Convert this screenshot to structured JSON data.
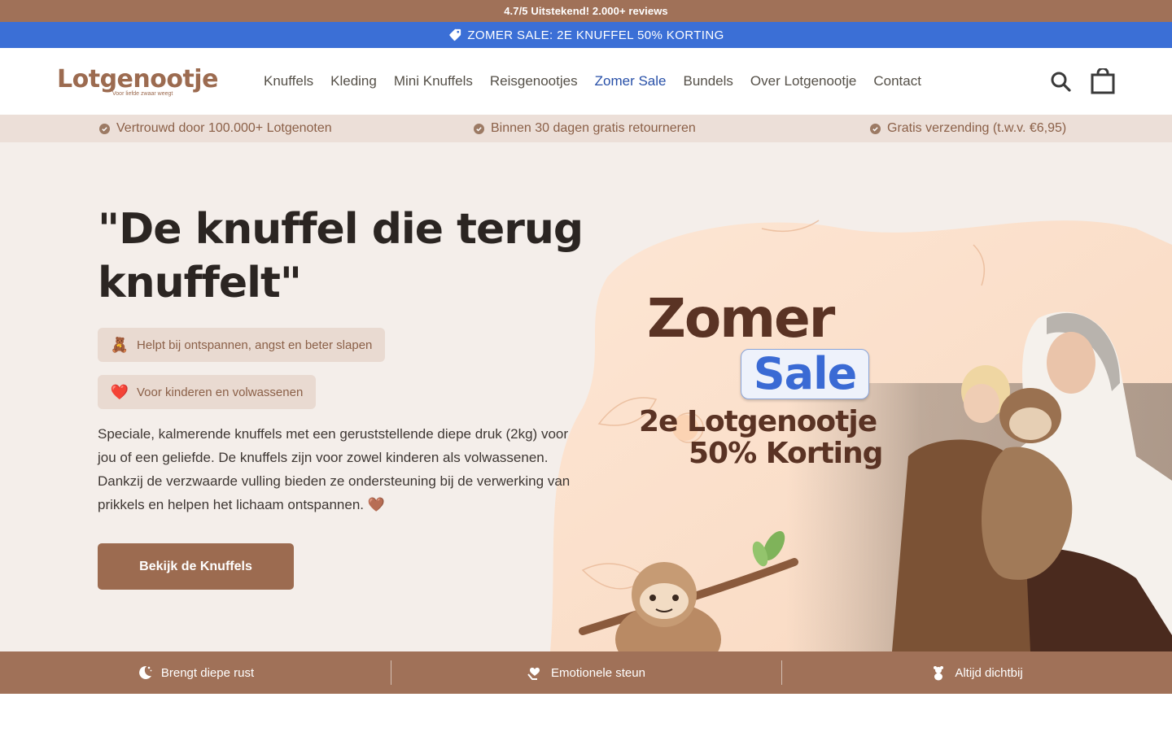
{
  "announcement": {
    "rating_text": "4.7/5 Uitstekend! 2.000+ reviews",
    "sale_text": "ZOMER SALE: 2E KNUFFEL 50% KORTING",
    "sale_icon": "tag-icon"
  },
  "header": {
    "logo_text": "Lotgenootje",
    "logo_tagline": "Voor liefde zwaar weegt",
    "nav": [
      {
        "label": "Knuffels"
      },
      {
        "label": "Kleding"
      },
      {
        "label": "Mini Knuffels"
      },
      {
        "label": "Reisgenootjes"
      },
      {
        "label": "Zomer Sale"
      },
      {
        "label": "Bundels"
      },
      {
        "label": "Over Lotgenootje"
      },
      {
        "label": "Contact"
      }
    ],
    "active_nav": "Zomer Sale",
    "icons": [
      "search-icon",
      "cart-icon"
    ]
  },
  "usp": [
    {
      "text": "Vertrouwd door 100.000+ Lotgenoten"
    },
    {
      "text": "Binnen 30 dagen gratis retourneren"
    },
    {
      "text": "Gratis verzending (t.w.v. €6,95)"
    }
  ],
  "hero": {
    "title": "\"De knuffel die terug knuffelt\"",
    "pills": [
      {
        "emoji": "🧸",
        "text": "Helpt bij ontspannen, angst en beter slapen"
      },
      {
        "emoji": "❤️",
        "text": "Voor kinderen en volwassenen"
      }
    ],
    "description": "Speciale, kalmerende knuffels met een geruststellende diepe druk (2kg) voor jou of een geliefde. De knuffels zijn voor zowel kinderen als volwassenen. Dankzij de verzwaarde vulling bieden ze ondersteuning bij de verwerking van prikkels en helpen het lichaam ontspannen. 🤎",
    "cta_label": "Bekijk de Knuffels"
  },
  "promo": {
    "zomer": "Zomer",
    "sale": "Sale",
    "line1": "2e Lotgenootje",
    "line2": "50% Korting"
  },
  "benefits": [
    {
      "icon": "moon-icon",
      "text": "Brengt diepe rust"
    },
    {
      "icon": "heart-hands-icon",
      "text": "Emotionele steun"
    },
    {
      "icon": "teddy-icon",
      "text": "Altijd dichtbij"
    }
  ],
  "colors": {
    "brand_brown": "#a07158",
    "sale_blue": "#3b6fd6",
    "usp_bg": "#ecdfd8",
    "hero_bg": "#f4eeea"
  }
}
